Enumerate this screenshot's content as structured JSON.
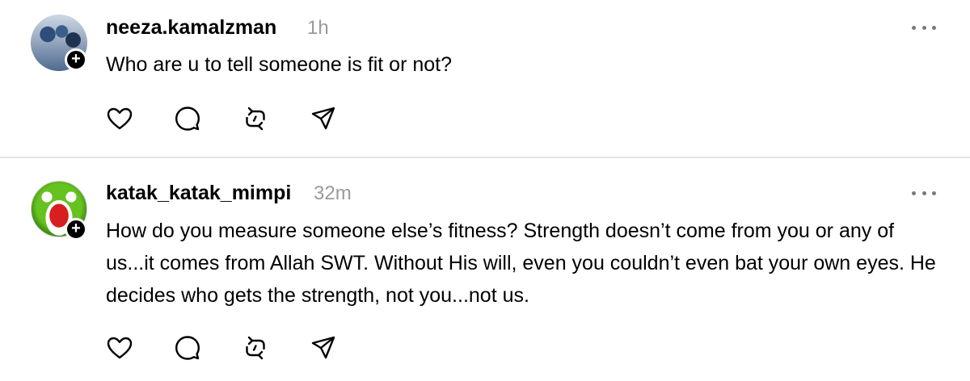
{
  "posts": [
    {
      "username": "neeza.kamalzman",
      "time": "1h",
      "text": "Who are u to tell someone is fit or not?",
      "follow_badge": "+",
      "avatar_icon": "family-photo-avatar"
    },
    {
      "username": "katak_katak_mimpi",
      "time": "32m",
      "text": "How do you measure someone else’s fitness? Strength doesn’t come from you or any of us...it comes from Allah SWT. Without His will, even you couldn’t even bat your own eyes. He decides who gets the strength, not you...not us.",
      "follow_badge": "+",
      "avatar_icon": "frog-avatar"
    }
  ],
  "actions": [
    "heart-icon",
    "comment-icon",
    "repost-icon",
    "share-icon"
  ],
  "colors": {
    "text": "#000000",
    "muted": "#9a9a9a",
    "divider": "#e4e4e4",
    "icon": "#000000"
  }
}
